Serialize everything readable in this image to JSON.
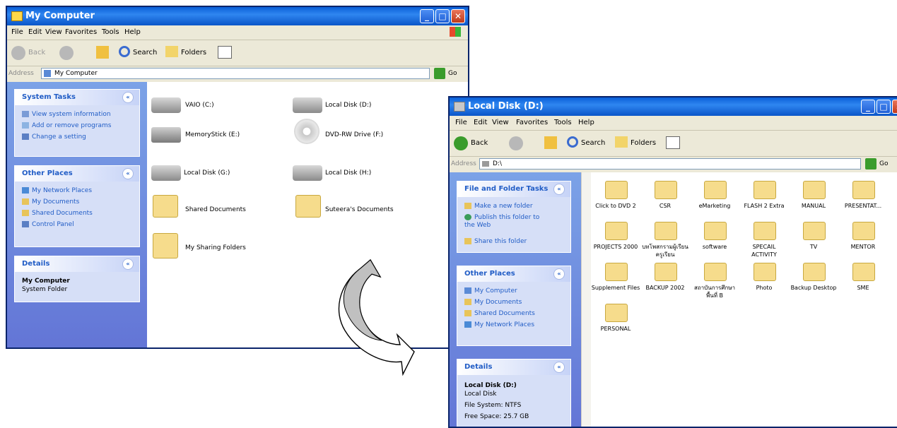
{
  "win1": {
    "title": "My Computer",
    "menu": [
      "File",
      "Edit",
      "View",
      "Favorites",
      "Tools",
      "Help"
    ],
    "toolbar": {
      "back": "Back",
      "search": "Search",
      "folders": "Folders"
    },
    "address": {
      "label": "Address",
      "value": "My Computer",
      "go": "Go"
    },
    "system_tasks": {
      "title": "System Tasks",
      "items": [
        "View system information",
        "Add or remove programs",
        "Change a setting"
      ]
    },
    "other_places": {
      "title": "Other Places",
      "items": [
        "My Network Places",
        "My Documents",
        "Shared Documents",
        "Control Panel"
      ]
    },
    "details": {
      "title": "Details",
      "name": "My Computer",
      "type": "System Folder"
    },
    "items": [
      "VAIO (C:)",
      "Local Disk (D:)",
      "MemoryStick (E:)",
      "DVD-RW Drive (F:)",
      "Local Disk (G:)",
      "Local Disk (H:)",
      "Shared Documents",
      "Suteera's Documents",
      "My Sharing Folders"
    ]
  },
  "win2": {
    "title": "Local Disk (D:)",
    "menu": [
      "File",
      "Edit",
      "View",
      "Favorites",
      "Tools",
      "Help"
    ],
    "toolbar": {
      "back": "Back",
      "search": "Search",
      "folders": "Folders"
    },
    "address": {
      "label": "Address",
      "value": "D:\\",
      "go": "Go"
    },
    "file_tasks": {
      "title": "File and Folder Tasks",
      "items": [
        "Make a new folder",
        "Publish this folder to the Web",
        "Share this folder"
      ]
    },
    "other_places": {
      "title": "Other Places",
      "items": [
        "My Computer",
        "My Documents",
        "Shared Documents",
        "My Network Places"
      ]
    },
    "details": {
      "title": "Details",
      "name": "Local Disk (D:)",
      "type": "Local Disk",
      "fs": "File System: NTFS",
      "free": "Free Space: 25.7 GB"
    },
    "folders": [
      "Click to DVD 2",
      "CSR",
      "eMarketing",
      "FLASH 2 Extra",
      "MANUAL",
      "PRESENTAT...",
      "PROJECTS 2000",
      "บทโพสกรามผู้เรียน ครูเรียน",
      "software",
      "SPECAIL ACTIVITY",
      "TV",
      "MENTOR",
      "Supplement Files",
      "BACKUP 2002",
      "สถาบันการศึกษาพื้นที่ B",
      "Photo",
      "Backup Desktop",
      "SME",
      "PERSONAL"
    ]
  }
}
